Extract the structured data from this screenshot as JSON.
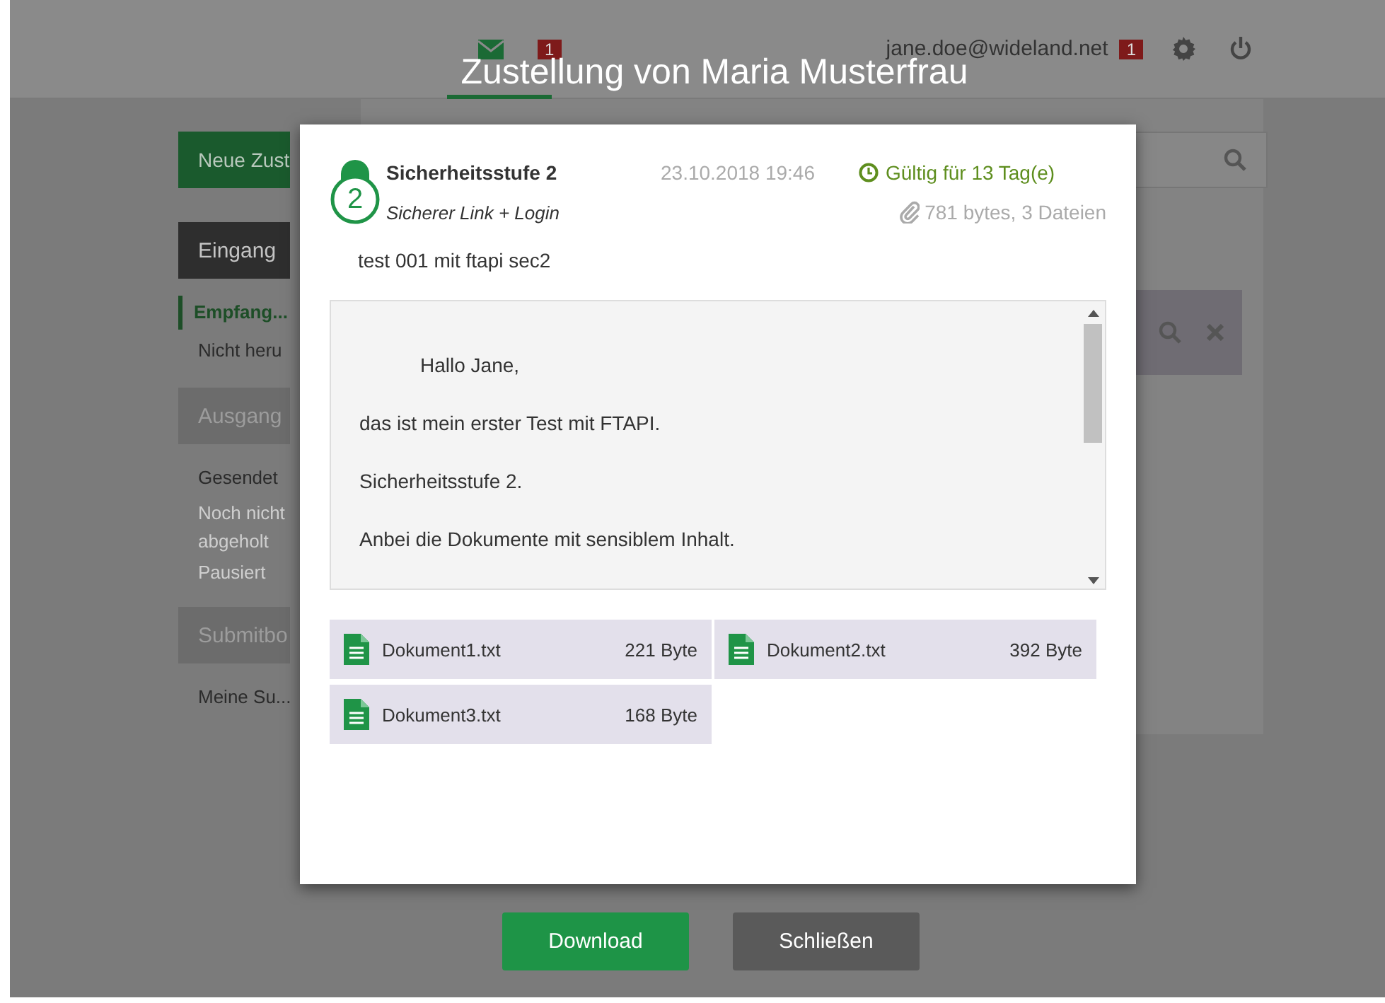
{
  "header": {
    "tabs": [
      {
        "kind": "mail",
        "badge": "1",
        "selected": true
      }
    ],
    "user": "jane.doe@wideland.net",
    "user_badge": "1"
  },
  "dialog_title": "Zustellung von Maria Musterfrau",
  "sidebar": {
    "new_button": "Neue Zust",
    "sections": [
      {
        "title": "Eingang",
        "selected": true,
        "items": [
          {
            "label": "Empfang...",
            "selected": true,
            "disabled": false
          },
          {
            "label": "Nicht heru",
            "selected": false,
            "disabled": false
          }
        ]
      },
      {
        "title": "Ausgang",
        "selected": false,
        "items": [
          {
            "label": "Gesendet",
            "selected": false,
            "disabled": false
          },
          {
            "label": "Noch nicht abgeholt",
            "selected": false,
            "disabled": true
          },
          {
            "label": "Pausiert",
            "selected": false,
            "disabled": true
          }
        ]
      },
      {
        "title": "Submitbo",
        "selected": false,
        "items": [
          {
            "label": "Meine Su...",
            "selected": false,
            "disabled": false
          }
        ]
      }
    ]
  },
  "dialog": {
    "security_level": "2",
    "security_title": "Sicherheitsstufe 2",
    "security_method": "Sicherer Link + Login",
    "date": "23.10.2018 19:46",
    "validity": "Gültig für 13 Tag(e)",
    "attachments_summary": "781 bytes, 3 Dateien",
    "subject": "test 001 mit ftapi sec2",
    "message": [
      {
        "text": "Hallo Jane,",
        "indented": true
      },
      {
        "text": "das ist mein erster Test mit FTAPI.",
        "indented": false
      },
      {
        "text": "Sicherheitsstufe 2.",
        "indented": false
      },
      {
        "text": "Anbei die Dokumente mit sensiblem Inhalt.",
        "indented": false
      }
    ],
    "files": [
      {
        "name": "Dokument1.txt",
        "size": "221 Byte"
      },
      {
        "name": "Dokument2.txt",
        "size": "392 Byte"
      },
      {
        "name": "Dokument3.txt",
        "size": "168 Byte"
      }
    ]
  },
  "buttons": [
    {
      "label": "Download",
      "kind": "primary"
    },
    {
      "label": "Schließen",
      "kind": "secondary"
    }
  ]
}
